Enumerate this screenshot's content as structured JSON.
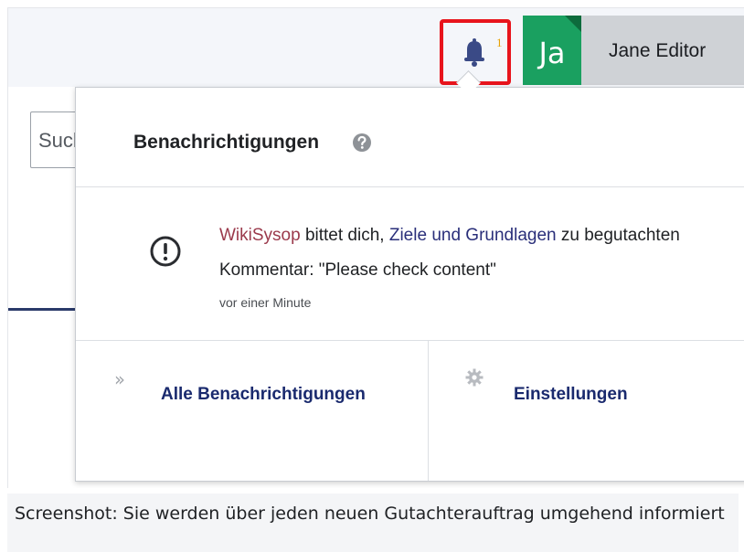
{
  "header": {
    "notification_count": "1",
    "avatar_initials": "Ja",
    "user_name": "Jane Editor"
  },
  "search": {
    "placeholder": "Suche"
  },
  "popup": {
    "title": "Benachrichtigungen",
    "notification": {
      "actor": "WikiSysop",
      "text_before": " bittet dich, ",
      "target": "Ziele und Grundlagen",
      "text_after": " zu begutachten",
      "comment": "Kommentar: \"Please check content\"",
      "time": "vor einer Minute"
    },
    "footer": {
      "all_label": "Alle Benachrichtigungen",
      "settings_label": "Einstellungen"
    }
  },
  "caption": "Screenshot: Sie werden über jeden neuen Gutachterauftrag umgehend informiert",
  "colors": {
    "highlight": "#e8141c",
    "avatar": "#1aa060",
    "link": "#1a2a6e",
    "actor": "#9b3a4c"
  }
}
